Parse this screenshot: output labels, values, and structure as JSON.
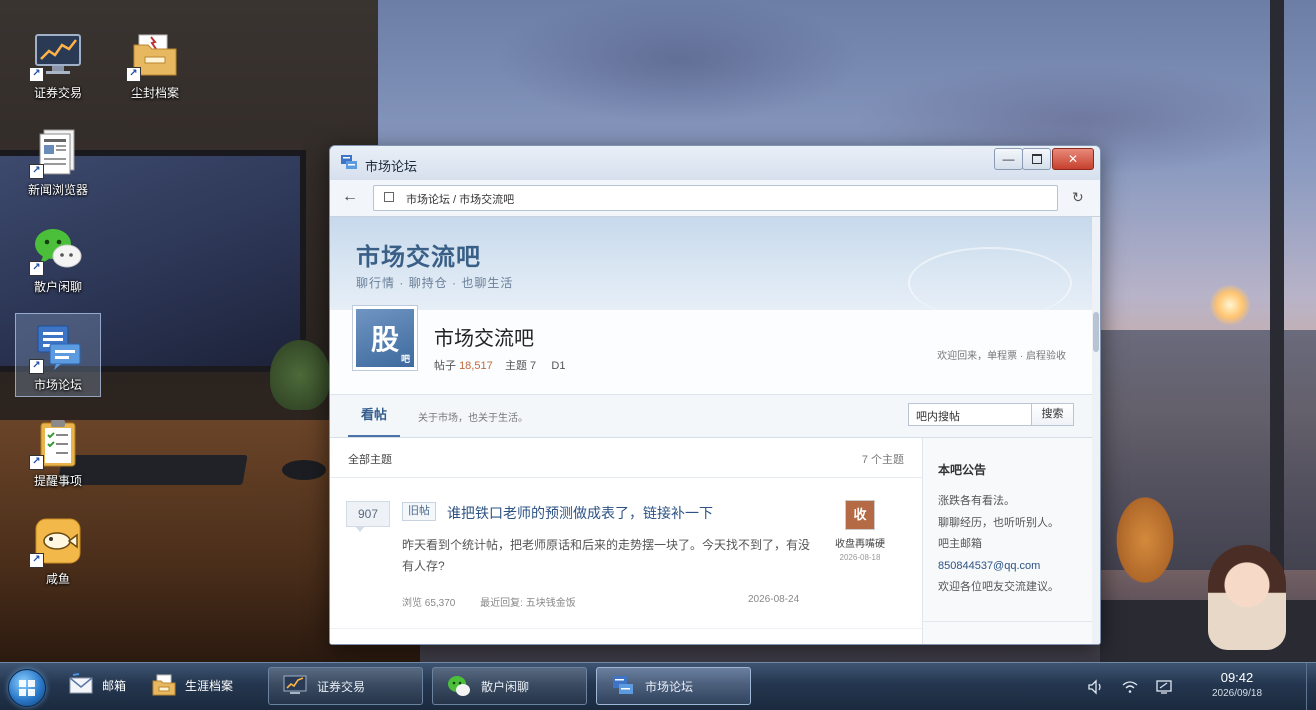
{
  "desktop": {
    "icons": [
      {
        "label": "证券交易",
        "icon": "stock-chart-icon"
      },
      {
        "label": "尘封档案",
        "icon": "archive-folder-icon"
      },
      {
        "label": "新闻浏览器",
        "icon": "news-document-icon"
      },
      {
        "label": "散户闲聊",
        "icon": "wechat-chat-icon"
      },
      {
        "label": "市场论坛",
        "icon": "forum-icon"
      },
      {
        "label": "提醒事项",
        "icon": "clipboard-checklist-icon"
      },
      {
        "label": "咸鱼",
        "icon": "fish-icon"
      }
    ],
    "selected_icon": "市场论坛"
  },
  "window": {
    "title": "市场论坛",
    "address": "市场论坛 / 市场交流吧",
    "banner": {
      "name": "市场交流吧",
      "tagline": "聊行情 · 聊持仓 · 也聊生活"
    },
    "forum": {
      "logo_char": "股",
      "logo_sub": "吧",
      "name": "市场交流吧",
      "posts_label": "帖子",
      "posts_count": "18,517",
      "topics_label": "主题",
      "topics_count": "7",
      "level": "D1",
      "welcome": "欢迎回来，单程票 · 启程验收"
    },
    "tabs": {
      "active": "看帖",
      "description": "关于市场，也关于生活。",
      "search_value": "吧内搜帖",
      "search_button": "搜索"
    },
    "list": {
      "header_all": "全部主题",
      "header_count": "7 个主题",
      "posts": [
        {
          "replies": "907",
          "badge": "旧帖",
          "title": "谁把铁口老师的预测做成表了，链接补一下",
          "excerpt": "昨天看到个统计帖，把老师原话和后来的走势摆一块了。今天找不到了，有没有人存?",
          "views": "浏览 65,370",
          "last_reply": "最近回复: 五块钱金饭",
          "date": "2026-08-24",
          "author_avatar": "收",
          "author_name": "收盘再嘴硬",
          "author_date": "2026-08-18"
        }
      ]
    },
    "sidebar": {
      "title": "本吧公告",
      "lines": [
        "涨跌各有看法。",
        "聊聊经历，也听听别人。",
        "吧主邮箱"
      ],
      "email": "850844537@qq.com",
      "last_line": "欢迎各位吧友交流建议。"
    }
  },
  "taskbar": {
    "quick_launch": [
      {
        "label": "邮箱",
        "icon": "mail-icon"
      },
      {
        "label": "生涯档案",
        "icon": "archive-folder-icon"
      }
    ],
    "tasks": [
      {
        "label": "证券交易",
        "icon": "stock-chart-icon",
        "active": false
      },
      {
        "label": "散户闲聊",
        "icon": "wechat-chat-icon",
        "active": false
      },
      {
        "label": "市场论坛",
        "icon": "forum-icon",
        "active": true
      }
    ],
    "clock_time": "09:42",
    "clock_date": "2026/09/18"
  },
  "colors": {
    "accent": "#3a5f86",
    "link": "#2d5384",
    "close_button": "#c7402e",
    "stat_number": "#c0683b"
  }
}
